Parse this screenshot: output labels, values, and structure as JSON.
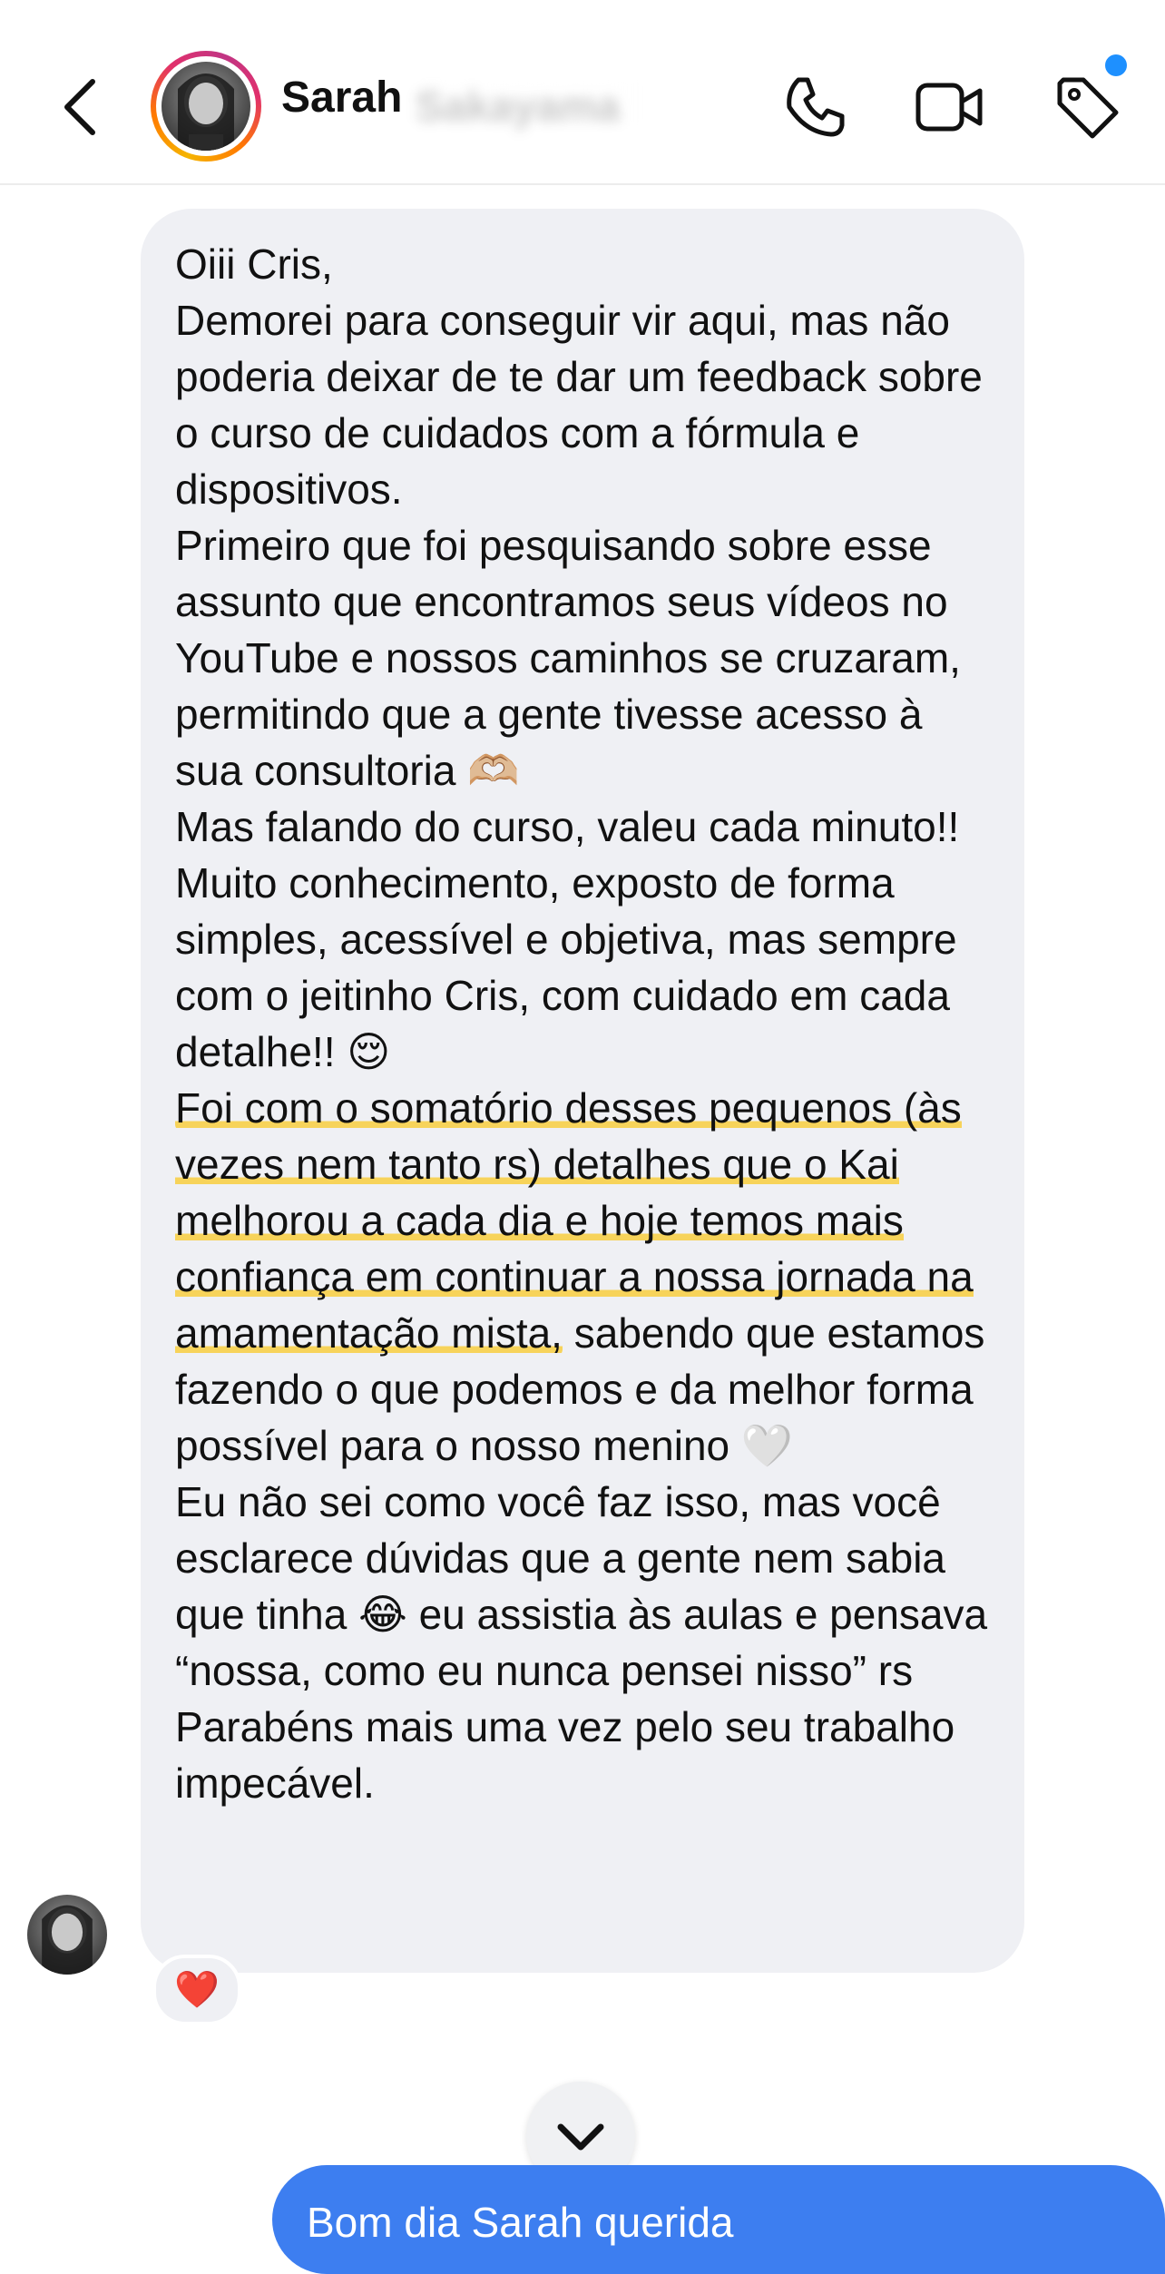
{
  "header": {
    "name": "Sarah",
    "name_obscured": "Sakayama",
    "icons": [
      "back-chevron-icon",
      "phone-icon",
      "video-camera-icon",
      "tag-icon"
    ]
  },
  "message": {
    "p1": "Oiii Cris,",
    "p2": "Demorei para conseguir vir aqui, mas não poderia deixar de te dar um feedback sobre o curso de cuidados com a fórmula e dispositivos.",
    "p3": "Primeiro que foi pesquisando sobre esse assunto que encontramos seus vídeos no YouTube e nossos caminhos se cruzaram, permitindo que a gente tivesse acesso à sua consultoria",
    "p3_emoji": "🫶🏼",
    "p4": "Mas falando do curso, valeu cada minuto!! Muito conhecimento, exposto de forma simples, acessível e objetiva, mas sempre com o jeitinho Cris, com cuidado em cada detalhe!!",
    "p4_emoji": "😌",
    "p5_highlight": "Foi com o somatório desses pequenos (às vezes nem tanto rs) detalhes que o Kai melhorou a cada dia e hoje temos mais confiança em continuar a nossa jornada na amamentação mista,",
    "p5_rest": "sabendo que estamos fazendo o que podemos e da melhor forma possível para o nosso menino",
    "p5_emoji": "🤍",
    "p6_a": "Eu não sei como você faz isso, mas você esclarece dúvidas que a gente nem sabia que tinha",
    "p6_emoji": "😂",
    "p6_b": "eu assistia às aulas e pensava “nossa, como eu nunca pensei nisso” rs",
    "p7": "Parabéns mais uma vez pelo seu trabalho impecável."
  },
  "reaction": "❤️",
  "outgoing": {
    "text": "Bom dia Sarah querida"
  },
  "colors": {
    "bubble": "#eff0f4",
    "highlight": "#f7d35a",
    "outgoing_bubble": "#3d7ef0",
    "notification_dot": "#1e90ff"
  }
}
